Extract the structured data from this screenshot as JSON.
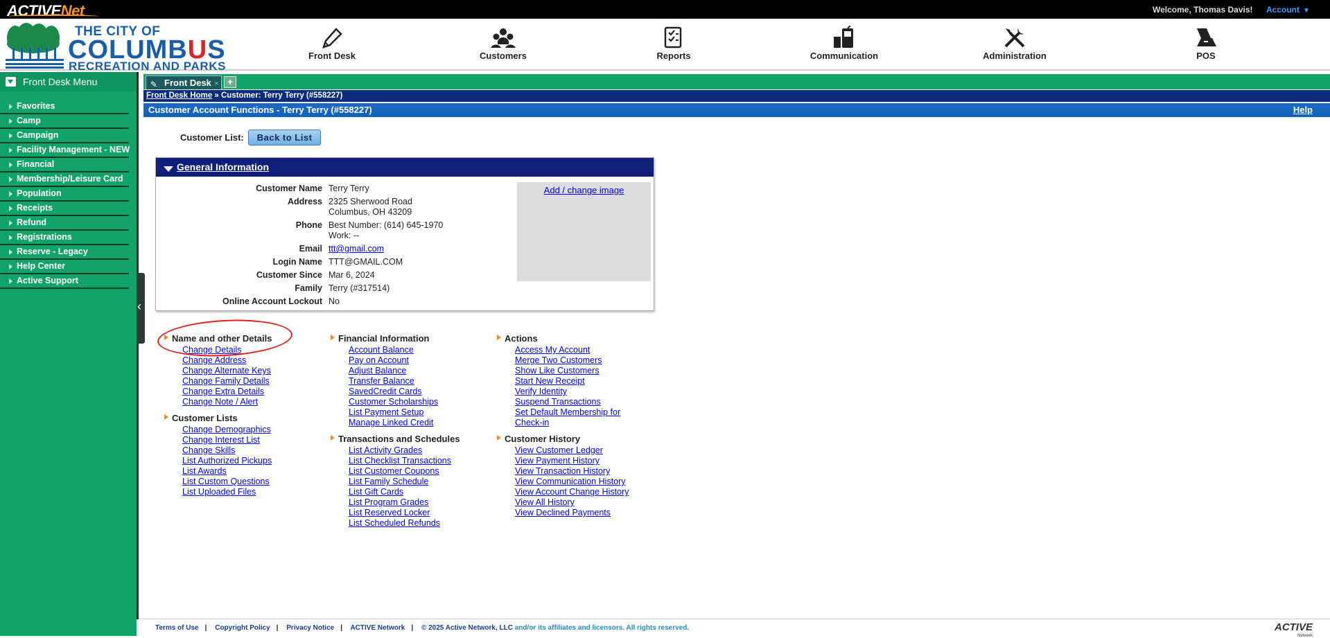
{
  "topbar": {
    "brand_main": "ACTIVE",
    "brand_accent": "Net",
    "welcome": "Welcome, Thomas Davis!",
    "account": "Account"
  },
  "logo": {
    "line1": "THE CITY OF",
    "line2_a": "COLUMB",
    "line2_b": "U",
    "line2_c": "S",
    "line3": "RECREATION AND PARKS"
  },
  "nav": [
    {
      "label": "Front Desk",
      "icon": "pencil-icon"
    },
    {
      "label": "Customers",
      "icon": "people-icon"
    },
    {
      "label": "Reports",
      "icon": "report-icon"
    },
    {
      "label": "Communication",
      "icon": "phone-icon"
    },
    {
      "label": "Administration",
      "icon": "tools-icon"
    },
    {
      "label": "POS",
      "icon": "pos-icon"
    }
  ],
  "sidebar": {
    "title": "Front Desk Menu",
    "items": [
      "Favorites",
      "Camp",
      "Campaign",
      "Facility Management - NEW",
      "Financial",
      "Membership/Leisure Card",
      "Population",
      "Receipts",
      "Refund",
      "Registrations",
      "Reserve - Legacy",
      "Help Center",
      "Active Support"
    ]
  },
  "tabs": {
    "active": "Front Desk",
    "add": "+"
  },
  "breadcrumb": {
    "home": "Front Desk Home",
    "current": " » Customer: Terry Terry (#558227)"
  },
  "titlebar": {
    "title": "Customer Account Functions - Terry Terry (#558227)",
    "help": "Help"
  },
  "customer_list": {
    "label": "Customer List:",
    "button": "Back to List"
  },
  "general": {
    "heading": "General Information",
    "image_link": "Add / change image",
    "labels": {
      "name": "Customer Name",
      "address": "Address",
      "phone": "Phone",
      "email": "Email",
      "login": "Login Name",
      "since": "Customer Since",
      "family": "Family",
      "lockout": "Online Account Lockout"
    },
    "values": {
      "name": "Terry Terry",
      "address1": "2325 Sherwood Road",
      "address2": "Columbus, OH 43209",
      "phone1": "Best Number: (614) 645-1970",
      "phone2": "Work: --",
      "email": "ttt@gmail.com",
      "login": "TTT@GMAIL.COM",
      "since": "Mar 6, 2024",
      "family": "Terry (#317514)",
      "lockout": "No"
    }
  },
  "functions": {
    "col1": [
      {
        "title": "Name and other Details",
        "links": [
          "Change Details",
          "Change Address",
          "Change Alternate Keys",
          "Change Family Details",
          "Change Extra Details",
          "Change Note / Alert"
        ]
      },
      {
        "title": "Customer Lists",
        "links": [
          "Change Demographics",
          "Change Interest List",
          "Change Skills",
          "List Authorized Pickups",
          "List Awards",
          "List Custom Questions",
          "List Uploaded Files"
        ]
      }
    ],
    "col2": [
      {
        "title": "Financial Information",
        "links": [
          "Account Balance",
          "Pay on Account",
          "Adjust Balance",
          "Transfer Balance",
          "SavedCredit Cards",
          "Customer Scholarships",
          "List Payment Setup",
          "Manage Linked Credit"
        ]
      },
      {
        "title": "Transactions and Schedules",
        "links": [
          "List Activity Grades",
          "List Checklist Transactions",
          "List Customer Coupons",
          "List Family Schedule",
          "List Gift Cards",
          "List Program Grades",
          "List Reserved Locker",
          "List Scheduled Refunds"
        ]
      }
    ],
    "col3": [
      {
        "title": "Actions",
        "links": [
          "Access My Account",
          "Merge Two Customers",
          "Show Like Customers",
          "Start New Receipt",
          "Verify Identity",
          "Suspend Transactions",
          "Set Default Membership for Check-in"
        ]
      },
      {
        "title": "Customer History",
        "links": [
          "View Customer Ledger",
          "View Payment History",
          "View Transaction History",
          "View Communication History",
          "View Account Change History",
          "View All History",
          "View Declined Payments"
        ]
      }
    ]
  },
  "footer": {
    "links": [
      "Terms of Use",
      "Copyright Policy",
      "Privacy Notice",
      "ACTIVE Network"
    ],
    "copyright": "© 2025 Active Network, LLC",
    "rest": " and/or its affiliates and licensors. All rights reserved.",
    "logo": "ACTIVE",
    "logo_sub": "Network"
  },
  "colors": {
    "sidebar": "#12a36b",
    "header_blue": "#0f1f7a",
    "title_blue": "#1062b6",
    "accent_orange": "#f08a1c",
    "annotation_red": "#e0201c"
  }
}
